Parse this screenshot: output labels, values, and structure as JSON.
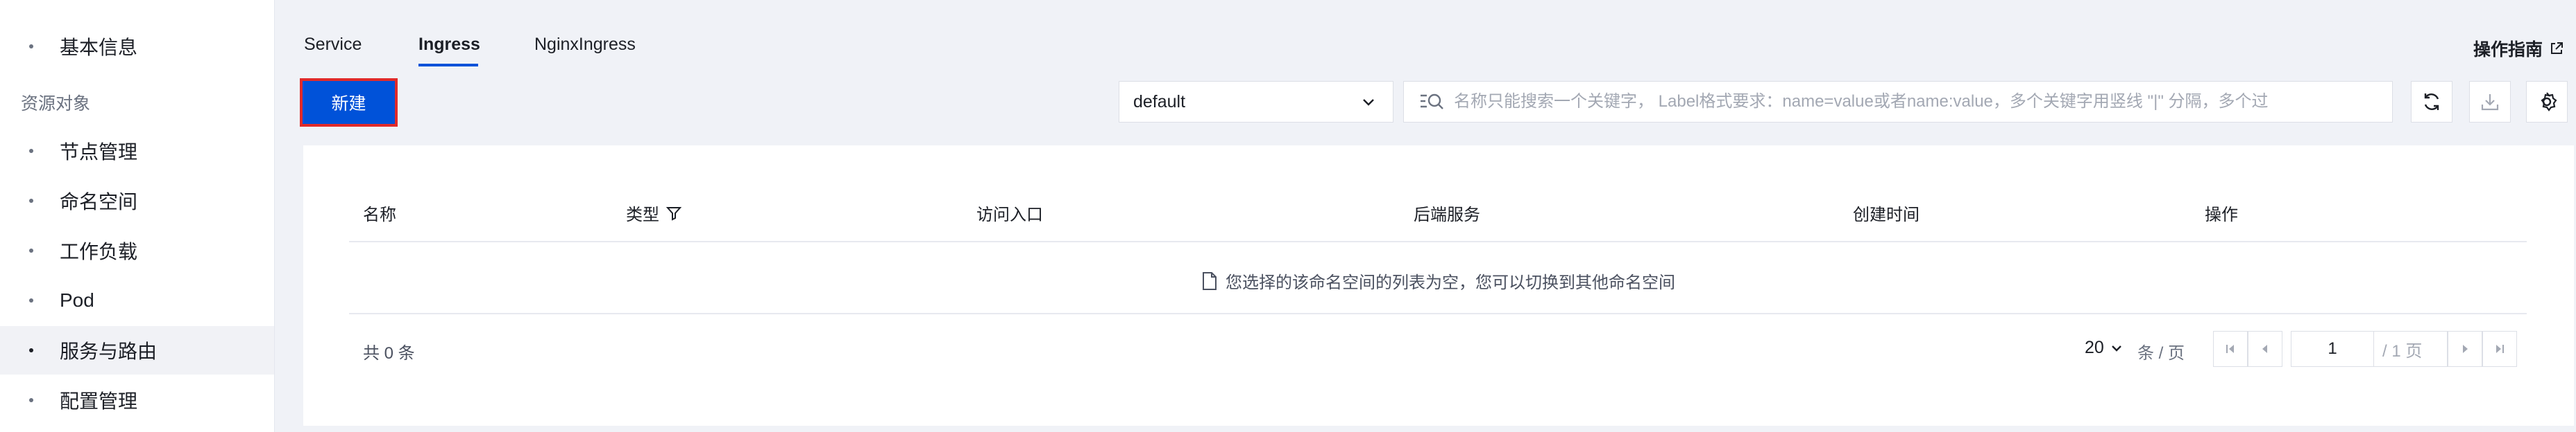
{
  "sidebar": {
    "items": [
      {
        "label": "基本信息"
      },
      {
        "label": "节点管理"
      },
      {
        "label": "命名空间"
      },
      {
        "label": "工作负载"
      },
      {
        "label": "Pod"
      },
      {
        "label": "服务与路由"
      },
      {
        "label": "配置管理"
      }
    ],
    "section_label": "资源对象",
    "active_index": 5
  },
  "tabs": [
    {
      "label": "Service"
    },
    {
      "label": "Ingress"
    },
    {
      "label": "NginxIngress"
    }
  ],
  "active_tab": "Ingress",
  "guide_label": "操作指南",
  "toolbar": {
    "create_label": "新建",
    "namespace_value": "default",
    "search_placeholder": "名称只能搜索一个关键字， Label格式要求：name=value或者name:value，多个关键字用竖线 \"|\" 分隔，多个过"
  },
  "table": {
    "columns": [
      "名称",
      "类型",
      "访问入口",
      "后端服务",
      "创建时间",
      "操作"
    ],
    "empty_message": "您选择的该命名空间的列表为空，您可以切换到其他命名空间",
    "total_label": "共 0 条"
  },
  "pagination": {
    "page_size": "20",
    "page_size_unit": "条 / 页",
    "current_page": "1",
    "total_pages_label": "/ 1 页"
  },
  "colors": {
    "primary": "#0052d9",
    "highlight_border": "#e02a2a",
    "background": "#f0f2f7"
  }
}
